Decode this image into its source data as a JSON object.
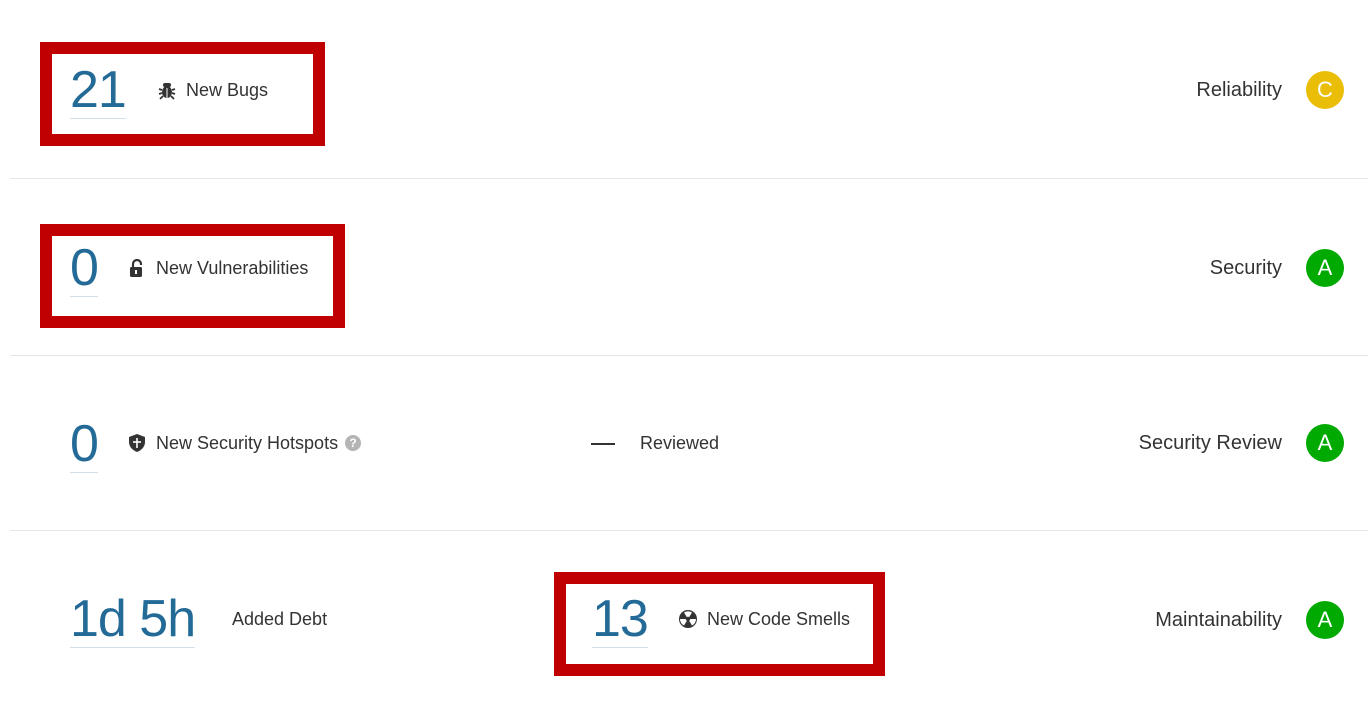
{
  "rows": [
    {
      "id": "reliability",
      "value": "21",
      "metric_label": "New Bugs",
      "metric_icon": "bug-icon",
      "rating_label": "Reliability",
      "rating": "C",
      "rating_color": "#eabe06"
    },
    {
      "id": "security",
      "value": "0",
      "metric_label": "New Vulnerabilities",
      "metric_icon": "unlocked-padlock-icon",
      "rating_label": "Security",
      "rating": "A",
      "rating_color": "#00aa00"
    },
    {
      "id": "security-review",
      "value": "0",
      "metric_label": "New Security Hotspots",
      "metric_icon": "shield-icon",
      "help_icon": "?",
      "secondary_value": "—",
      "secondary_label": "Reviewed",
      "rating_label": "Security Review",
      "rating": "A",
      "rating_color": "#00aa00"
    },
    {
      "id": "maintainability",
      "value": "1d 5h",
      "metric_label": "Added Debt",
      "secondary_value": "13",
      "secondary_label": "New Code Smells",
      "secondary_icon": "code-smell-icon",
      "rating_label": "Maintainability",
      "rating": "A",
      "rating_color": "#00aa00"
    }
  ],
  "highlight_color": "#c00000",
  "value_color": "#236a97"
}
